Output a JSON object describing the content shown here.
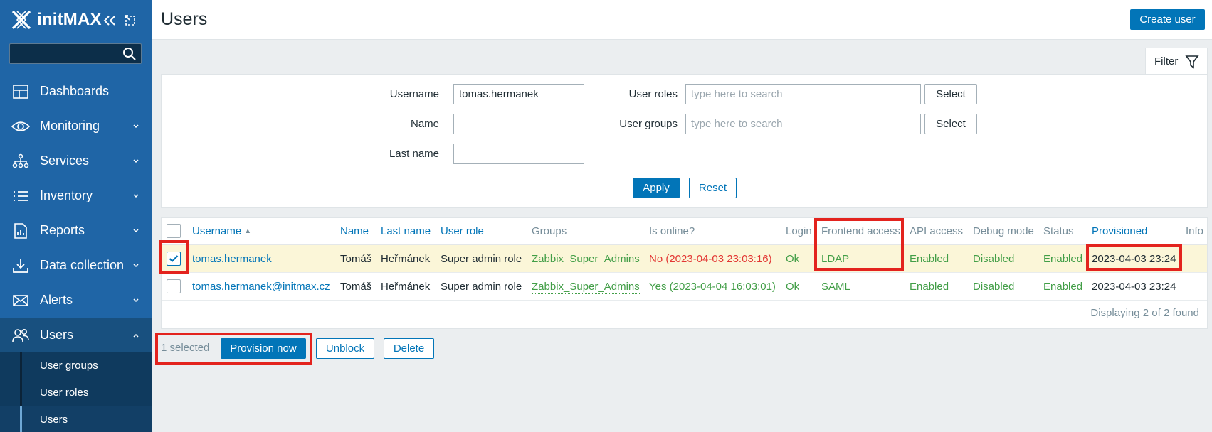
{
  "app": {
    "brand": "initMAX"
  },
  "sidebar": {
    "search_placeholder": "",
    "items": [
      {
        "label": "Dashboards",
        "icon": "dashboard-icon",
        "expandable": false
      },
      {
        "label": "Monitoring",
        "icon": "eye-icon",
        "expandable": true
      },
      {
        "label": "Services",
        "icon": "services-icon",
        "expandable": true
      },
      {
        "label": "Inventory",
        "icon": "list-icon",
        "expandable": true
      },
      {
        "label": "Reports",
        "icon": "reports-icon",
        "expandable": true
      },
      {
        "label": "Data collection",
        "icon": "download-icon",
        "expandable": true
      },
      {
        "label": "Alerts",
        "icon": "envelope-icon",
        "expandable": true
      },
      {
        "label": "Users",
        "icon": "users-icon",
        "expandable": true,
        "expanded": true
      }
    ],
    "subitems": [
      {
        "label": "User groups"
      },
      {
        "label": "User roles"
      },
      {
        "label": "Users",
        "current": true
      }
    ]
  },
  "header": {
    "title": "Users",
    "create_label": "Create user"
  },
  "filter": {
    "tab_label": "Filter",
    "username_label": "Username",
    "username_value": "tomas.hermanek",
    "name_label": "Name",
    "name_value": "",
    "lastname_label": "Last name",
    "lastname_value": "",
    "roles_label": "User roles",
    "roles_placeholder": "type here to search",
    "groups_label": "User groups",
    "groups_placeholder": "type here to search",
    "select_label": "Select",
    "apply_label": "Apply",
    "reset_label": "Reset"
  },
  "table": {
    "columns": [
      "Username",
      "Name",
      "Last name",
      "User role",
      "Groups",
      "Is online?",
      "Login",
      "Frontend access",
      "API access",
      "Debug mode",
      "Status",
      "Provisioned",
      "Info"
    ],
    "sort_indicator": "▲",
    "rows": [
      {
        "selected": true,
        "username": "tomas.hermanek",
        "name": "Tomáš",
        "last_name": "Heřmánek",
        "role": "Super admin role",
        "groups": "Zabbix_Super_Admins",
        "online": "No (2023-04-03 23:03:16)",
        "online_status": "no",
        "login": "Ok",
        "frontend": "LDAP",
        "api": "Enabled",
        "debug": "Disabled",
        "status": "Enabled",
        "provisioned": "2023-04-03 23:24"
      },
      {
        "selected": false,
        "username": "tomas.hermanek@initmax.cz",
        "name": "Tomáš",
        "last_name": "Heřmánek",
        "role": "Super admin role",
        "groups": "Zabbix_Super_Admins",
        "online": "Yes (2023-04-04 16:03:01)",
        "online_status": "yes",
        "login": "Ok",
        "frontend": "SAML",
        "api": "Enabled",
        "debug": "Disabled",
        "status": "Enabled",
        "provisioned": "2023-04-03 23:24"
      }
    ],
    "footer": "Displaying 2 of 2 found"
  },
  "actions": {
    "selected_count": "1 selected",
    "provision_label": "Provision now",
    "unblock_label": "Unblock",
    "delete_label": "Delete"
  },
  "colors": {
    "sidebar": "#1f65a6",
    "accent": "#0275b8",
    "ok_green": "#429e47",
    "error_red": "#e33734",
    "selected_row": "#fbf6d8",
    "highlight": "#e3231e"
  }
}
